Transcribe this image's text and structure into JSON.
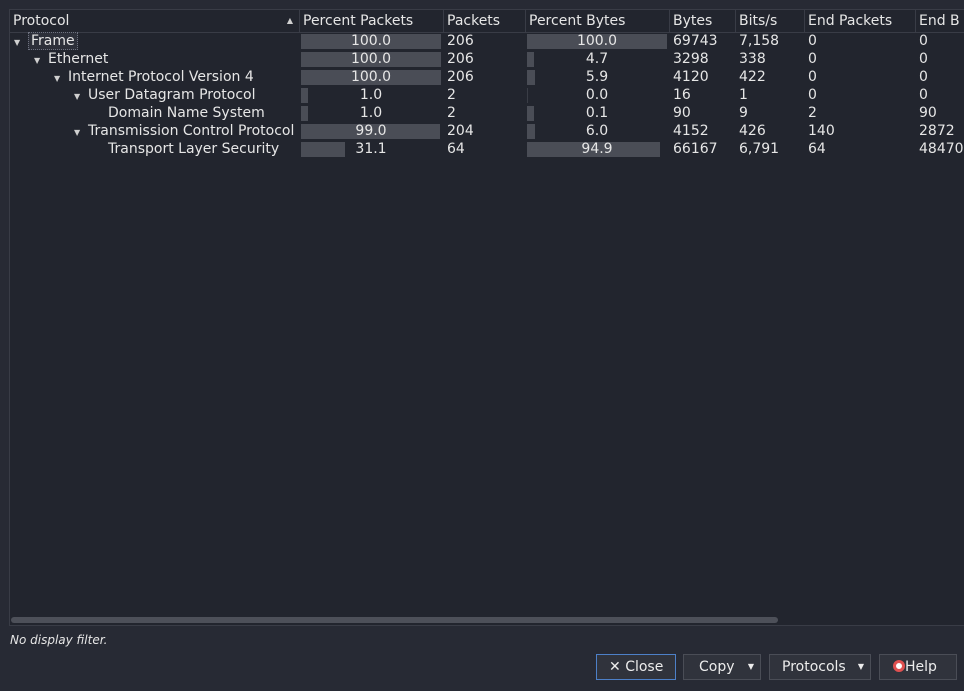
{
  "columns": [
    {
      "label": "Protocol"
    },
    {
      "label": "Percent Packets"
    },
    {
      "label": "Packets"
    },
    {
      "label": "Percent Bytes"
    },
    {
      "label": "Bytes"
    },
    {
      "label": "Bits/s"
    },
    {
      "label": "End Packets"
    },
    {
      "label": "End B"
    }
  ],
  "rows": [
    {
      "protocol": "Frame",
      "level": 0,
      "expandable": true,
      "pct_packets": "100.0",
      "pct_packets_value": 100.0,
      "packets": "206",
      "pct_bytes": "100.0",
      "pct_bytes_value": 100.0,
      "bytes": "69743",
      "bits": "7,158",
      "end_packets": "0",
      "end_bytes": "0"
    },
    {
      "protocol": "Ethernet",
      "level": 1,
      "expandable": true,
      "pct_packets": "100.0",
      "pct_packets_value": 100.0,
      "packets": "206",
      "pct_bytes": "4.7",
      "pct_bytes_value": 4.7,
      "bytes": "3298",
      "bits": "338",
      "end_packets": "0",
      "end_bytes": "0"
    },
    {
      "protocol": "Internet Protocol Version 4",
      "level": 2,
      "expandable": true,
      "pct_packets": "100.0",
      "pct_packets_value": 100.0,
      "packets": "206",
      "pct_bytes": "5.9",
      "pct_bytes_value": 5.9,
      "bytes": "4120",
      "bits": "422",
      "end_packets": "0",
      "end_bytes": "0"
    },
    {
      "protocol": "User Datagram Protocol",
      "level": 3,
      "expandable": true,
      "pct_packets": "1.0",
      "pct_packets_value": 1.0,
      "packets": "2",
      "pct_bytes": "0.0",
      "pct_bytes_value": 0.0,
      "bytes": "16",
      "bits": "1",
      "end_packets": "0",
      "end_bytes": "0"
    },
    {
      "protocol": "Domain Name System",
      "level": 4,
      "expandable": false,
      "pct_packets": "1.0",
      "pct_packets_value": 1.0,
      "packets": "2",
      "pct_bytes": "0.1",
      "pct_bytes_value": 0.1,
      "bytes": "90",
      "bits": "9",
      "end_packets": "2",
      "end_bytes": "90"
    },
    {
      "protocol": "Transmission Control Protocol",
      "level": 3,
      "expandable": true,
      "pct_packets": "99.0",
      "pct_packets_value": 99.0,
      "packets": "204",
      "pct_bytes": "6.0",
      "pct_bytes_value": 6.0,
      "bytes": "4152",
      "bits": "426",
      "end_packets": "140",
      "end_bytes": "2872"
    },
    {
      "protocol": "Transport Layer Security",
      "level": 4,
      "expandable": false,
      "pct_packets": "31.1",
      "pct_packets_value": 31.1,
      "packets": "64",
      "pct_bytes": "94.9",
      "pct_bytes_value": 94.9,
      "bytes": "66167",
      "bits": "6,791",
      "end_packets": "64",
      "end_bytes": "48470"
    }
  ],
  "status_text": "No display filter.",
  "buttons": {
    "close": "Close",
    "copy": "Copy",
    "protocols": "Protocols",
    "help": "Help"
  },
  "icons": {
    "sort": "sort-ascending-icon",
    "expand": "chevron-down-icon",
    "close": "close-icon",
    "help": "lifebuoy-icon"
  },
  "colors": {
    "background": "#272a34",
    "tree_background": "#22252e",
    "bar": "#4a4d56",
    "default_button_border": "#4d80c8"
  }
}
